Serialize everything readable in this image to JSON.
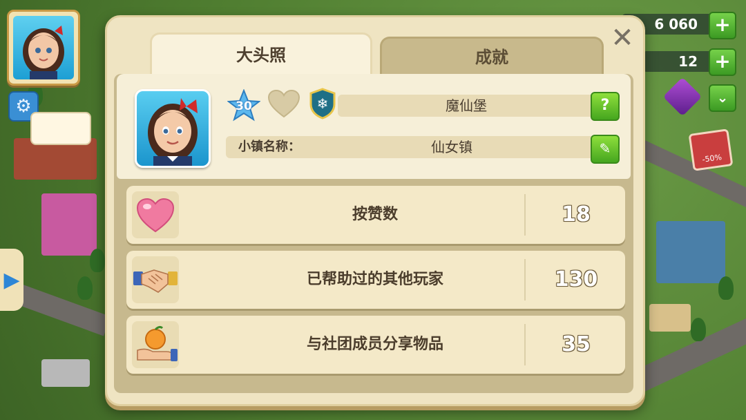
{
  "hud": {
    "player_level": "30",
    "coins": "6 060",
    "cash": "12",
    "sale_badge": "-50%"
  },
  "dialog": {
    "tabs": [
      {
        "label": "大头照",
        "active": true
      },
      {
        "label": "成就",
        "active": false
      }
    ],
    "profile": {
      "level": "30",
      "town_title": "魔仙堡",
      "town_name_label": "小镇名称：",
      "town_name": "仙女镇"
    },
    "stats": [
      {
        "icon": "heart-icon",
        "label": "按赞数",
        "value": "18"
      },
      {
        "icon": "handshake-icon",
        "label": "已帮助过的其他玩家",
        "value": "130"
      },
      {
        "icon": "gift-orange-icon",
        "label": "与社团成员分享物品",
        "value": "35"
      }
    ]
  },
  "colors": {
    "dialog_bg": "#efe4c2",
    "accent_green": "#45a61f",
    "accent_blue": "#1b95cd"
  }
}
